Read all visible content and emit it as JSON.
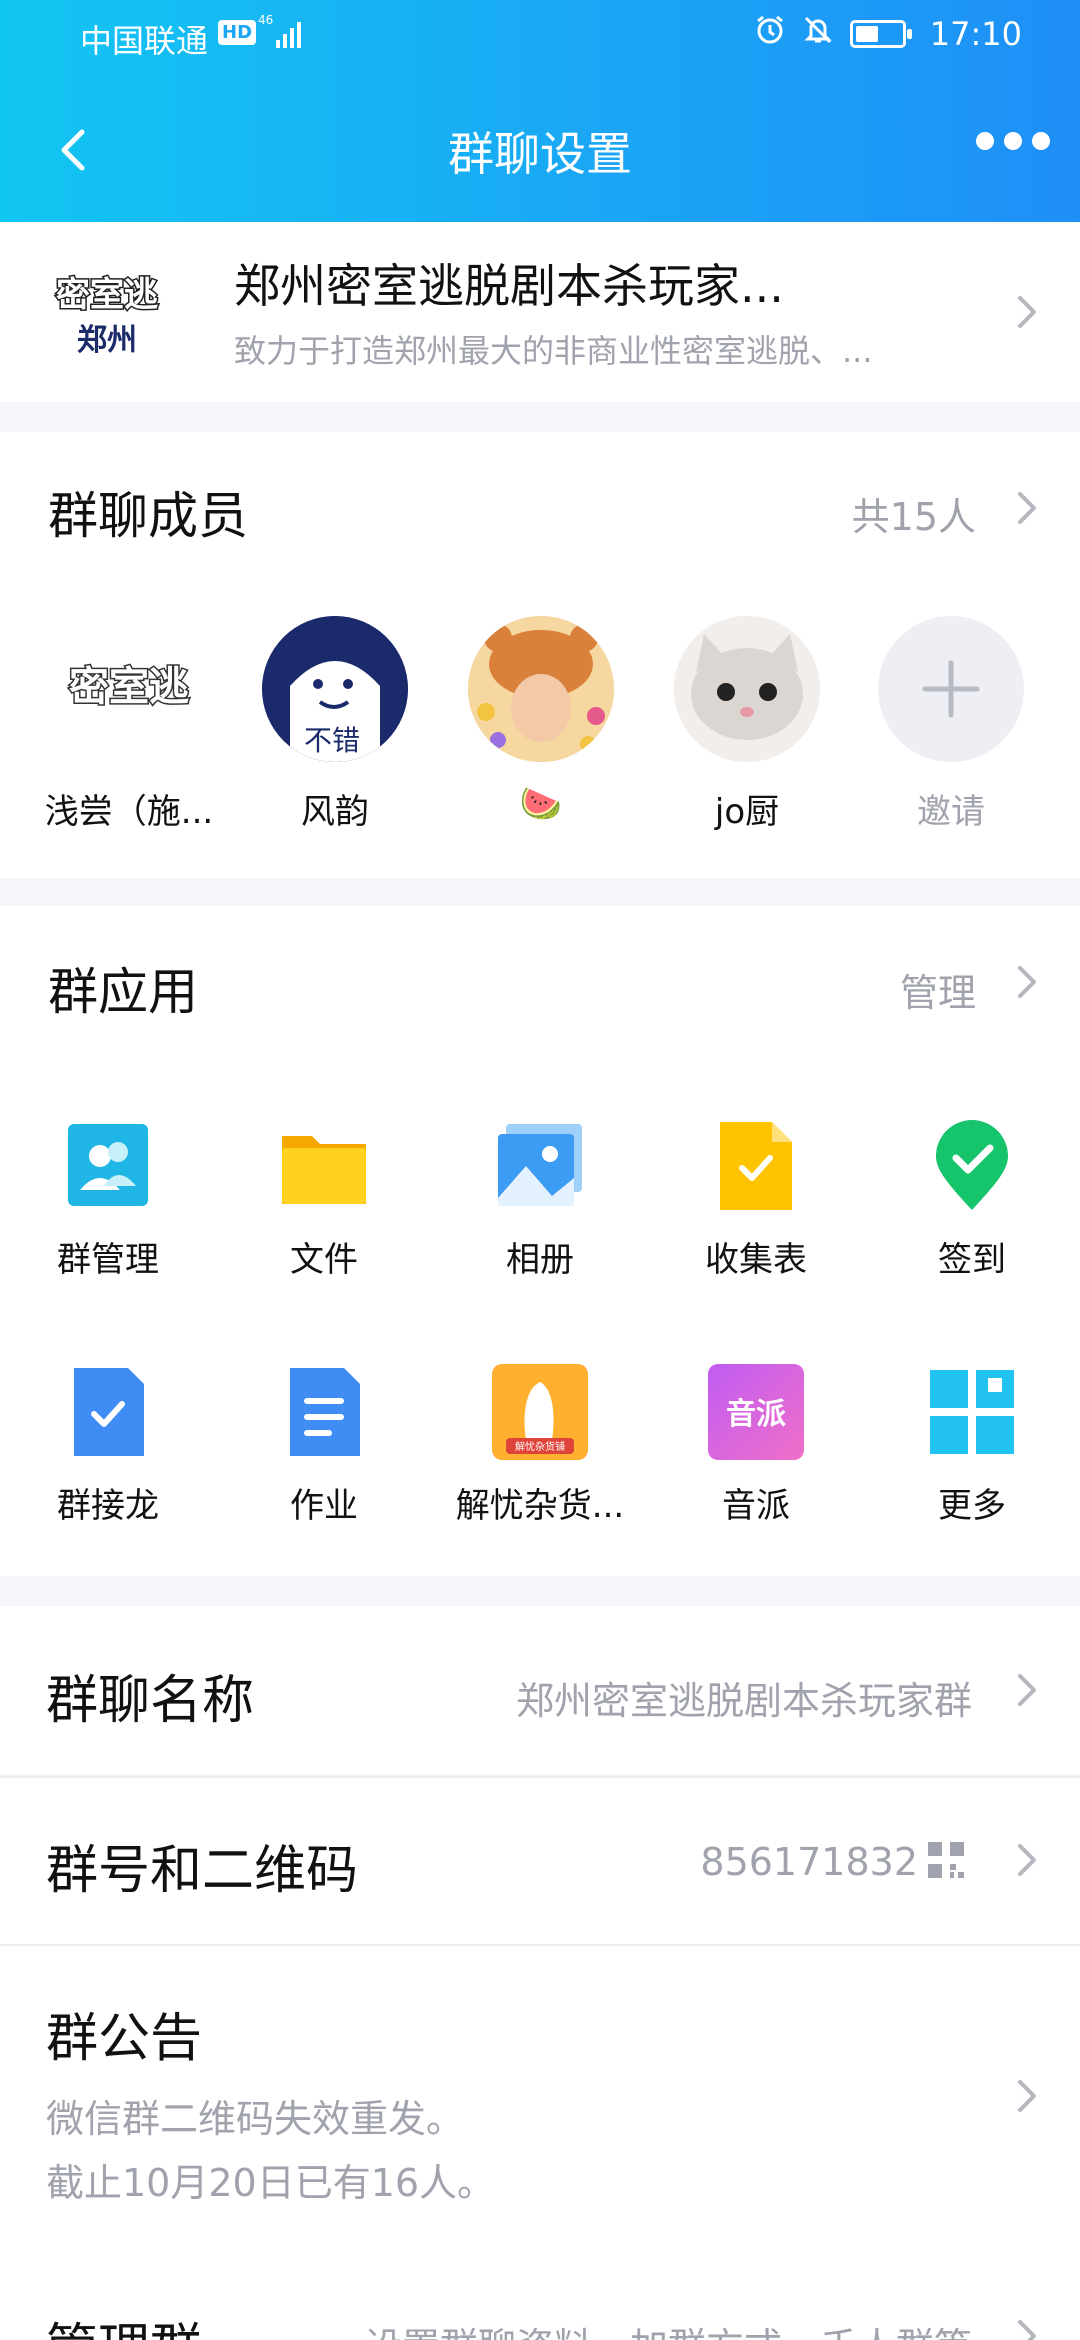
{
  "status_bar": {
    "carrier": "中国联通",
    "hd": "HD",
    "network": "46",
    "time": "17:10",
    "battery_level": 0.5
  },
  "nav": {
    "title": "群聊设置"
  },
  "group": {
    "logo_text_top": "密室逃",
    "logo_text_bottom": "郑州",
    "name": "郑州密室逃脱剧本杀玩家...",
    "description": "致力于打造郑州最大的非商业性密室逃脱、..."
  },
  "members": {
    "title": "群聊成员",
    "count_label": "共15人",
    "items": [
      {
        "name": "浅尝（施...",
        "avatar_text": "密室逃"
      },
      {
        "name": "风韵",
        "avatar_text": "不错"
      },
      {
        "name": "🍉",
        "avatar_text": ""
      },
      {
        "name": "jo厨",
        "avatar_text": ""
      }
    ],
    "invite_label": "邀请"
  },
  "apps": {
    "title": "群应用",
    "manage_label": "管理",
    "items": [
      {
        "label": "群管理",
        "icon": "group-manage-icon"
      },
      {
        "label": "文件",
        "icon": "folder-icon"
      },
      {
        "label": "相册",
        "icon": "album-icon"
      },
      {
        "label": "收集表",
        "icon": "collect-form-icon"
      },
      {
        "label": "签到",
        "icon": "checkin-icon"
      },
      {
        "label": "群接龙",
        "icon": "relay-icon"
      },
      {
        "label": "作业",
        "icon": "homework-icon"
      },
      {
        "label": "解忧杂货...",
        "icon": "grocery-icon"
      },
      {
        "label": "音派",
        "icon": "yinpai-icon"
      },
      {
        "label": "更多",
        "icon": "more-grid-icon"
      }
    ],
    "grocery_badge": "解忧杂货铺",
    "yinpai_text": "音派"
  },
  "settings": {
    "name_label": "群聊名称",
    "name_value": "郑州密室逃脱剧本杀玩家群",
    "id_label": "群号和二维码",
    "id_value": "856171832",
    "notice_label": "群公告",
    "notice_line1": "微信群二维码失效重发。",
    "notice_line2": "截止10月20日已有16人。",
    "manage_label": "管理群",
    "manage_value": "设置群聊资料、加群方式、千人群等"
  },
  "colors": {
    "header_start": "#12c6f2",
    "header_end": "#1e8ff6",
    "secondary_text": "#a0a3ad"
  }
}
